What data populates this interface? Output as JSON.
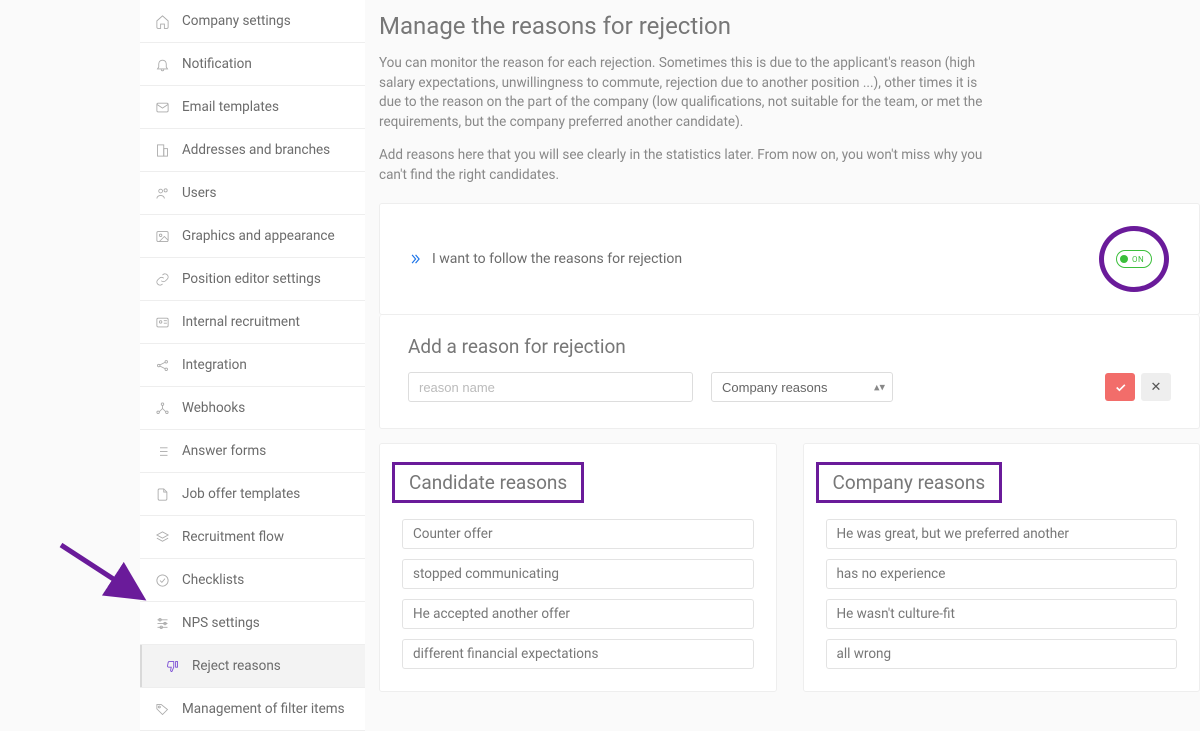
{
  "sidebar": {
    "items": [
      {
        "label": "Company settings",
        "icon": "home-icon"
      },
      {
        "label": "Notification",
        "icon": "bell-icon"
      },
      {
        "label": "Email templates",
        "icon": "mail-icon"
      },
      {
        "label": "Addresses and branches",
        "icon": "building-icon"
      },
      {
        "label": "Users",
        "icon": "users-icon"
      },
      {
        "label": "Graphics and appearance",
        "icon": "image-icon"
      },
      {
        "label": "Position editor settings",
        "icon": "link-icon"
      },
      {
        "label": "Internal recruitment",
        "icon": "id-icon"
      },
      {
        "label": "Integration",
        "icon": "share-icon"
      },
      {
        "label": "Webhooks",
        "icon": "node-icon"
      },
      {
        "label": "Answer forms",
        "icon": "list-icon"
      },
      {
        "label": "Job offer templates",
        "icon": "file-icon"
      },
      {
        "label": "Recruitment flow",
        "icon": "layers-icon"
      },
      {
        "label": "Checklists",
        "icon": "checkcircle-icon"
      },
      {
        "label": "NPS settings",
        "icon": "sliders-icon"
      },
      {
        "label": "Reject reasons",
        "icon": "thumbdown-icon",
        "active": true
      },
      {
        "label": "Management of filter items",
        "icon": "tag-icon"
      }
    ]
  },
  "page": {
    "title": "Manage the reasons for rejection",
    "intro1": "You can monitor the reason for each rejection. Sometimes this is due to the applicant's reason (high salary expectations, unwillingness to commute, rejection due to another position ...), other times it is due to the reason on the part of the company (low qualifications, not suitable for the team, or met the requirements, but the company preferred another candidate).",
    "intro2": "Add reasons here that you will see clearly in the statistics later. From now on, you won't miss why you can't find the right candidates."
  },
  "follow": {
    "label": "I want to follow the reasons for rejection",
    "toggle_label": "ON"
  },
  "add": {
    "title": "Add a reason for rejection",
    "placeholder": "reason name",
    "select_value": "Company reasons"
  },
  "columns": {
    "candidate": {
      "title": "Candidate reasons",
      "items": [
        "Counter offer",
        "stopped communicating",
        "He accepted another offer",
        "different financial expectations"
      ]
    },
    "company": {
      "title": "Company reasons",
      "items": [
        "He was great, but we preferred another",
        "has no experience",
        "He wasn't culture-fit",
        "all wrong"
      ]
    }
  }
}
